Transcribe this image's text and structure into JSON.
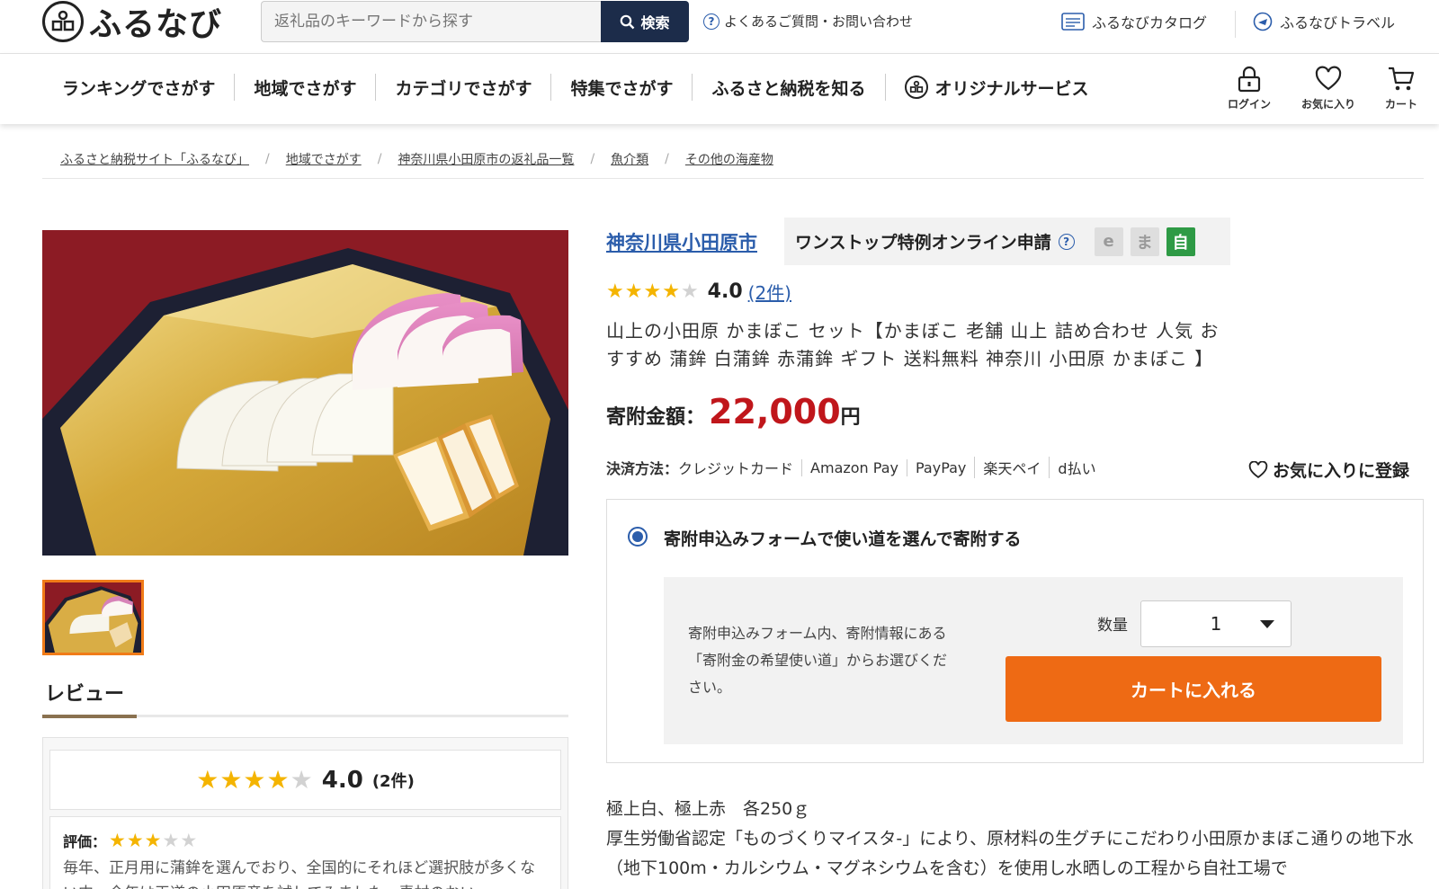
{
  "header": {
    "logo_text": "ふるなび",
    "search_placeholder": "返礼品のキーワードから探す",
    "search_button": "検索",
    "faq_link": "よくあるご質問・お問い合わせ",
    "catalog_link": "ふるなびカタログ",
    "travel_link": "ふるなびトラベル",
    "icons": {
      "login": "ログイン",
      "favorites": "お気に入り",
      "cart": "カート"
    }
  },
  "nav": {
    "items": [
      "ランキングでさがす",
      "地域でさがす",
      "カテゴリでさがす",
      "特集でさがす",
      "ふるさと納税を知る",
      "オリジナルサービス"
    ]
  },
  "breadcrumb": [
    "ふるさと納税サイト「ふるなび」",
    "地域でさがす",
    "神奈川県小田原市の返礼品一覧",
    "魚介類",
    "その他の海産物"
  ],
  "product": {
    "city": "神奈川県小田原市",
    "onestop_label": "ワンストップ特例オンライン申請",
    "onestop_badges": [
      "e",
      "ま",
      "自"
    ],
    "rating": 4.0,
    "rating_text": "4.0",
    "review_count_link": "(2件)",
    "title": "山上の小田原 かまぼこ セット【かまぼこ 老舗 山上 詰め合わせ 人気 おすすめ 蒲鉾 白蒲鉾 赤蒲鉾 ギフト 送料無料 神奈川 小田原 かまぼこ 】",
    "price_label": "寄附金額：",
    "price_value": "22,000",
    "price_unit": "円",
    "payment_label": "決済方法：",
    "payment_methods": [
      "クレジットカード",
      "Amazon Pay",
      "PayPay",
      "楽天ペイ",
      "d払い"
    ],
    "favorite_label": "お気に入りに登録"
  },
  "form": {
    "option_label": "寄附申込みフォームで使い道を選んで寄附する",
    "note": "寄附申込みフォーム内、寄附情報にある「寄附金の希望使い道」からお選びください。",
    "quantity_label": "数量",
    "quantity_value": "1",
    "cart_button": "カートに入れる"
  },
  "description": {
    "line1": "極上白、極上赤　各250ｇ",
    "line2": "厚生労働省認定「ものづくりマイスタ-」により、原材料の生グチにこだわり小田原かまぼこ通りの地下水（地下100m・カルシウム・マグネシウムを含む）を使用し水晒しの工程から自社工場で"
  },
  "reviews": {
    "tab_label": "レビュー",
    "summary_score": "4.0",
    "summary_count": "(2件)",
    "summary_stars": 4,
    "item_label": "評価：",
    "item_stars": 3,
    "item_text": "毎年、正月用に蒲鉾を選んでおり、全国的にそれほど選択肢が多くない中、今年は王道の小田原産を試してみました。素材のおい"
  },
  "colors": {
    "accent_orange": "#ee6a14",
    "price_red": "#c0161b",
    "link_blue": "#2b5dab",
    "search_navy": "#1c2c4a",
    "star_gold": "#f4b400",
    "badge_green": "#2e9a45"
  }
}
